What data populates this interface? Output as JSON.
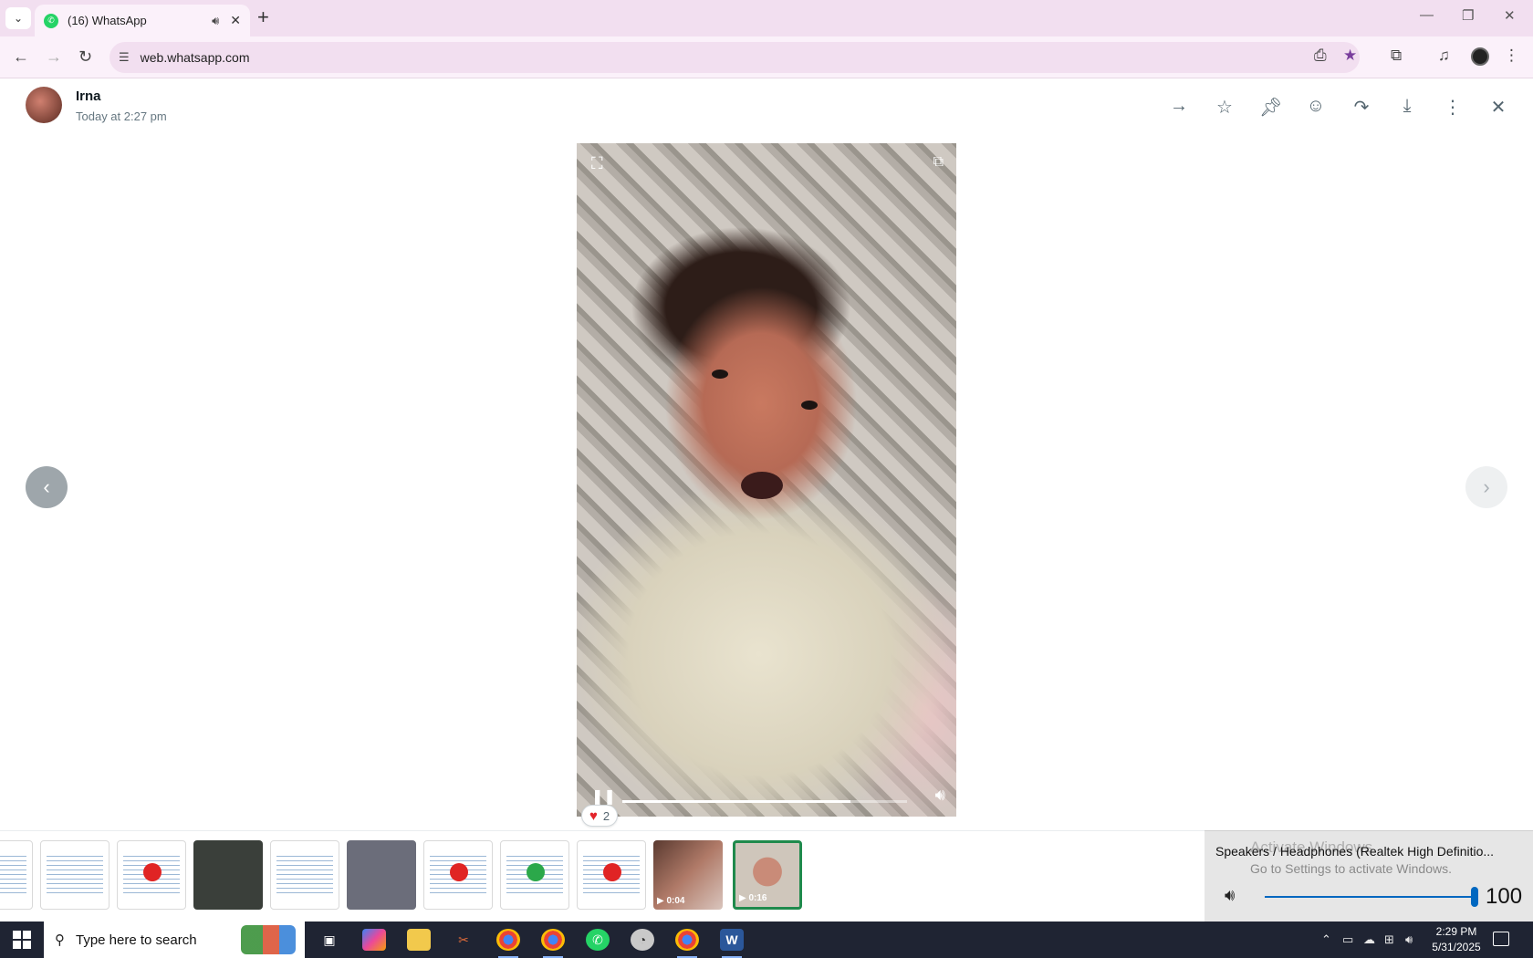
{
  "browser": {
    "tab_title": "(16) WhatsApp",
    "url": "web.whatsapp.com",
    "new_tab_glyph": "+"
  },
  "viewer": {
    "sender_name": "Irna",
    "sent_time": "Today at 2:27 pm",
    "header_actions": [
      "forward-arrow-icon",
      "star-icon",
      "pin-icon",
      "emoji-icon",
      "share-icon",
      "download-icon",
      "more-icon",
      "close-icon"
    ]
  },
  "video": {
    "progress": 0.8,
    "reaction_count": "2"
  },
  "thumbnails": [
    {
      "kind": "doc",
      "duration": ""
    },
    {
      "kind": "doc",
      "duration": ""
    },
    {
      "kind": "doc-power",
      "duration": ""
    },
    {
      "kind": "photo",
      "duration": ""
    },
    {
      "kind": "doc",
      "duration": ""
    },
    {
      "kind": "photo",
      "duration": ""
    },
    {
      "kind": "doc-power",
      "duration": ""
    },
    {
      "kind": "doc-power-green",
      "duration": ""
    },
    {
      "kind": "doc-power",
      "duration": ""
    },
    {
      "kind": "video",
      "duration": "0:04"
    },
    {
      "kind": "video-selected",
      "duration": "0:16"
    }
  ],
  "volume_flyout": {
    "device": "Speakers / Headphones (Realtek High Definitio...",
    "watermark_line1": "Activate Windows",
    "watermark_line2": "Go to Settings to activate Windows.",
    "level": "100"
  },
  "taskbar": {
    "search_placeholder": "Type here to search",
    "time": "2:29 PM",
    "date": "5/31/2025"
  },
  "colors": {
    "accent_green": "#1f8a4c",
    "chrome_pink": "#f2dff0",
    "volume_blue": "#0067c0"
  }
}
